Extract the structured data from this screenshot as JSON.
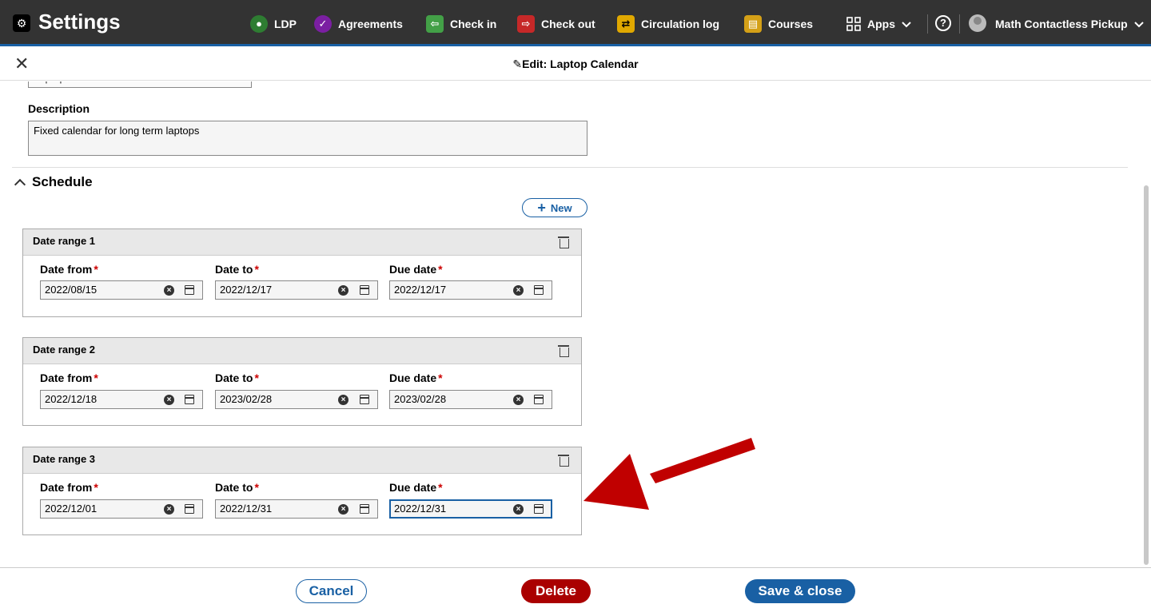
{
  "app": {
    "title": "Settings"
  },
  "nav": {
    "items": [
      {
        "label": "LDP",
        "icon": "ldp-icon",
        "color": "#2e7d32"
      },
      {
        "label": "Agreements",
        "icon": "agreements-icon",
        "color": "#7b1fa2"
      },
      {
        "label": "Check in",
        "icon": "check-in-icon",
        "color": "#43a047"
      },
      {
        "label": "Check out",
        "icon": "check-out-icon",
        "color": "#c62828"
      },
      {
        "label": "Circulation log",
        "icon": "circulation-log-icon",
        "color": "#e0a800"
      },
      {
        "label": "Courses",
        "icon": "courses-icon",
        "color": "#d4a017"
      }
    ],
    "apps_label": "Apps",
    "user_label": "Math Contactless Pickup"
  },
  "edit": {
    "title": "Edit: Laptop Calendar"
  },
  "form": {
    "name_value": "Laptop Calendar",
    "description_label": "Description",
    "description_value": "Fixed calendar for long term laptops"
  },
  "schedule": {
    "title": "Schedule",
    "new_label": "New",
    "ranges": [
      {
        "title": "Date range 1",
        "from_label": "Date from",
        "to_label": "Date to",
        "due_label": "Due date",
        "from": "2022/08/15",
        "to": "2022/12/17",
        "due": "2022/12/17"
      },
      {
        "title": "Date range 2",
        "from_label": "Date from",
        "to_label": "Date to",
        "due_label": "Due date",
        "from": "2022/12/18",
        "to": "2023/02/28",
        "due": "2023/02/28"
      },
      {
        "title": "Date range 3",
        "from_label": "Date from",
        "to_label": "Date to",
        "due_label": "Due date",
        "from": "2022/12/01",
        "to": "2022/12/31",
        "due": "2022/12/31"
      }
    ]
  },
  "footer": {
    "cancel": "Cancel",
    "delete": "Delete",
    "save": "Save & close"
  },
  "colors": {
    "accent": "#1960a4",
    "danger": "#aa0000",
    "arrow": "#c00000"
  }
}
